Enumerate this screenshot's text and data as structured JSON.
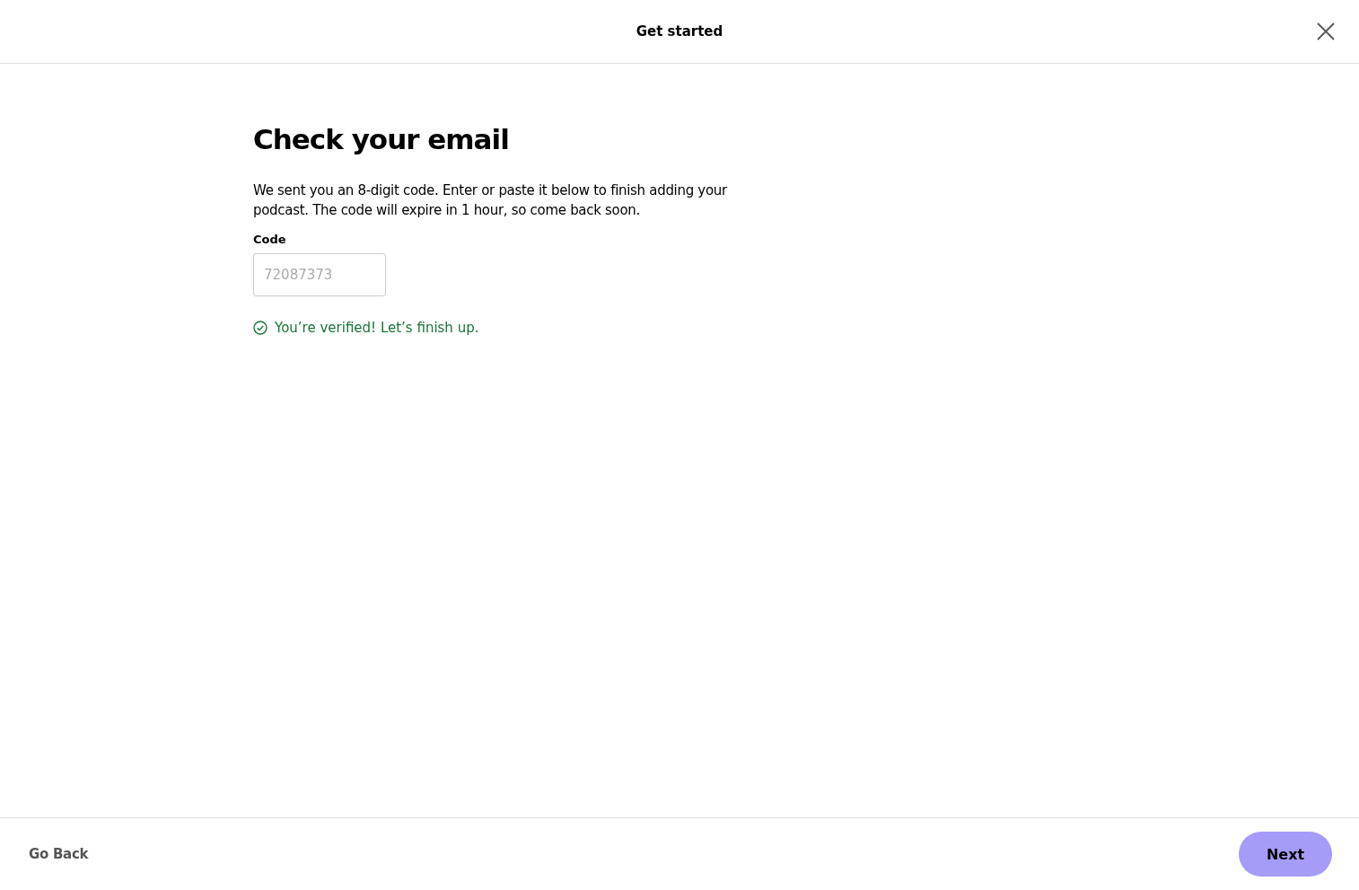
{
  "header": {
    "title": "Get started"
  },
  "heading": "Check your email",
  "description": "We sent you an 8-digit code. Enter or paste it below to finish adding your podcast. The code will expire in 1 hour, so come back soon.",
  "code_field": {
    "label": "Code",
    "value": "72087373",
    "disabled": true
  },
  "status": {
    "kind": "success",
    "text": "You’re verified! Let’s finish up."
  },
  "footer": {
    "back": "Go Back",
    "next": "Next"
  }
}
